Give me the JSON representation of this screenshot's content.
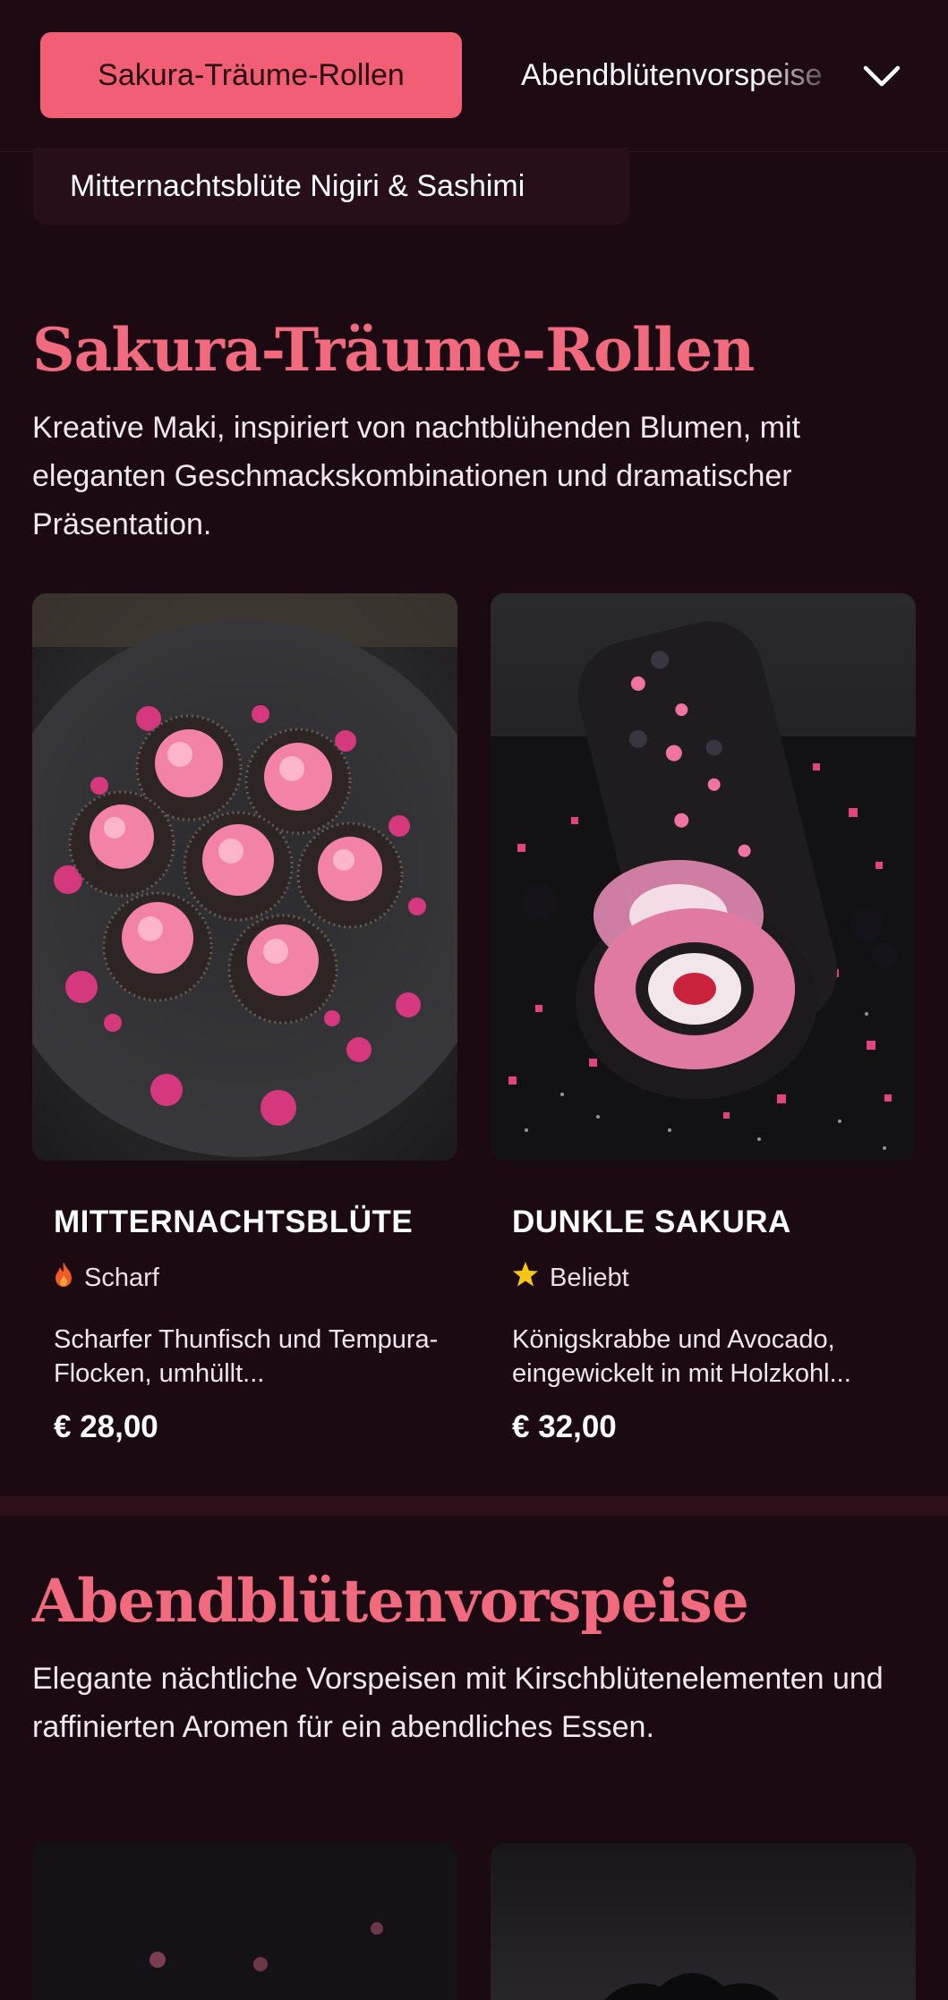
{
  "nav": {
    "active_tab": "Sakura-Träume-Rollen",
    "next_tab": "Abendblütenvorspeise",
    "chip_tab": "Mitternachtsblüte Nigiri & Sashimi"
  },
  "sections": [
    {
      "title": "Sakura-Träume-Rollen",
      "description": "Kreative Maki, inspiriert von nachtblühenden Blumen, mit eleganten Geschmackskombinationen und dramatischer Präsentation.",
      "items": [
        {
          "name": "MITTERNACHTSBLÜTE",
          "tag_icon": "flame-icon",
          "tag": "Scharf",
          "description": "Scharfer Thunfisch und Tempura-Flocken, umhüllt...",
          "price": "€ 28,00"
        },
        {
          "name": "DUNKLE SAKURA",
          "tag_icon": "star-icon",
          "tag": "Beliebt",
          "description": "Königskrabbe und Avocado, eingewickelt in mit Holzkohl...",
          "price": "€ 32,00"
        }
      ]
    },
    {
      "title": "Abendblütenvorspeise",
      "description": "Elegante nächtliche Vorspeisen mit Kirschblütenelementen und raffinierten Aromen für ein abendliches Essen."
    }
  ],
  "colors": {
    "background": "#1c0a12",
    "accent": "#f25e73",
    "heading": "#f26a7d",
    "flame": "#f05a28",
    "star": "#f5c518"
  }
}
